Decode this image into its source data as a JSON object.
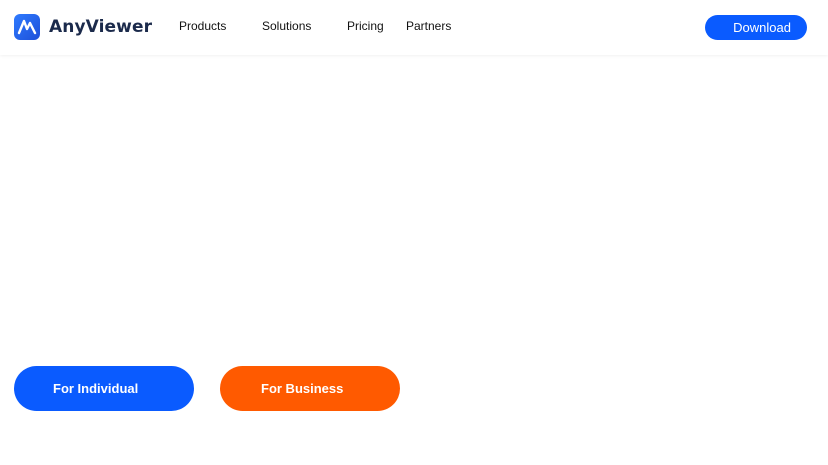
{
  "header": {
    "brand": {
      "name": "AnyViewer",
      "icon": "anyviewer-logo-icon"
    },
    "nav": [
      {
        "label": "Products"
      },
      {
        "label": "Solutions"
      },
      {
        "label": "Pricing"
      },
      {
        "label": "Partners"
      }
    ],
    "download_label": "Download"
  },
  "hero": {
    "individual_label": "For Individual",
    "business_label": "For Business"
  },
  "colors": {
    "primary_blue": "#0a5bff",
    "business_orange": "#ff5a00",
    "brand_text": "#1b2a4b"
  }
}
